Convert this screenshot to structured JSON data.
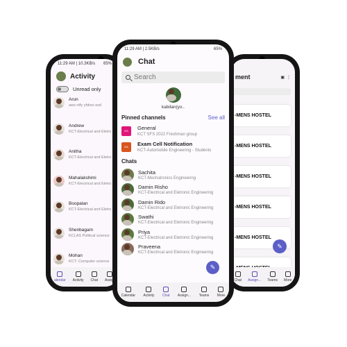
{
  "left_phone": {
    "status": {
      "time": "11:29 AM | 10.3KB/s",
      "battery": "65%"
    },
    "title": "Activity",
    "unread_label": "Unread only",
    "items": [
      {
        "name": "Arun",
        "sub": "aws ntfy yfdres esd"
      },
      {
        "name": "Andrew",
        "sub": "KCT-Electrical and Eletro"
      },
      {
        "name": "Anitha",
        "sub": "KCT-Electrical and Eletro"
      },
      {
        "name": "Mahalakshimi",
        "sub": "KCT-Electrical and Eletro"
      },
      {
        "name": "Boopalan",
        "sub": "KCT-Electrical and Eletro"
      },
      {
        "name": "Shenbagam",
        "sub": "KCLAS Political science"
      },
      {
        "name": "Mohan",
        "sub": "KCT- Computer science"
      }
    ],
    "nav": [
      "alendar",
      "Activity",
      "Chat",
      "Assign"
    ]
  },
  "center_phone": {
    "status": {
      "time": "11:29 AM | 2.5KB/s",
      "battery": "65%"
    },
    "title": "Chat",
    "search_placeholder": "Search",
    "profile_name": "kabilan(yo..",
    "pinned_title": "Pinned channels",
    "see_all": "See all",
    "pinned": [
      {
        "tile": "KS",
        "name": "General",
        "sub": "KCT SFS 2022 Freshman group",
        "color": "#e0157a"
      },
      {
        "tile": "EA",
        "name": "Exam Cell Notification",
        "sub": "KCT-Automobile Engineering - Students",
        "color": "#d9541e"
      }
    ],
    "chats_title": "Chats",
    "chats": [
      {
        "name": "Sachita",
        "sub": "KCT-Mechatronics Engineering"
      },
      {
        "name": "Damin Risho",
        "sub": "KCT-Electrical and Eletronic Engineering"
      },
      {
        "name": "Damin Rido",
        "sub": "KCT-Electrical and Eletronic Engineering"
      },
      {
        "name": "Swathi",
        "sub": "KCT-Electrical and Eletronic Engineering"
      },
      {
        "name": "Priya",
        "sub": "KCT-Electrical and Eletronic Engineering"
      },
      {
        "name": "Praveena",
        "sub": "KCT-Electrical and Eletronic Engineering"
      }
    ],
    "nav": [
      "Calendar",
      "Activity",
      "Chat",
      "Assign...",
      "Teams",
      "More"
    ],
    "active_nav": "Chat"
  },
  "right_phone": {
    "title": "ment",
    "cards": [
      "-MENS HOSTEL",
      "-MENS HOSTEL",
      "-MENS HOSTEL",
      "-MENS HOSTEL",
      "-MENS HOSTEL",
      "-MENS HOSTEL"
    ],
    "nav": [
      "Chat",
      "Assign...",
      "Teams",
      "More"
    ]
  },
  "colors": {
    "accent": "#5b5fc7",
    "phone_frame": "#151515"
  }
}
